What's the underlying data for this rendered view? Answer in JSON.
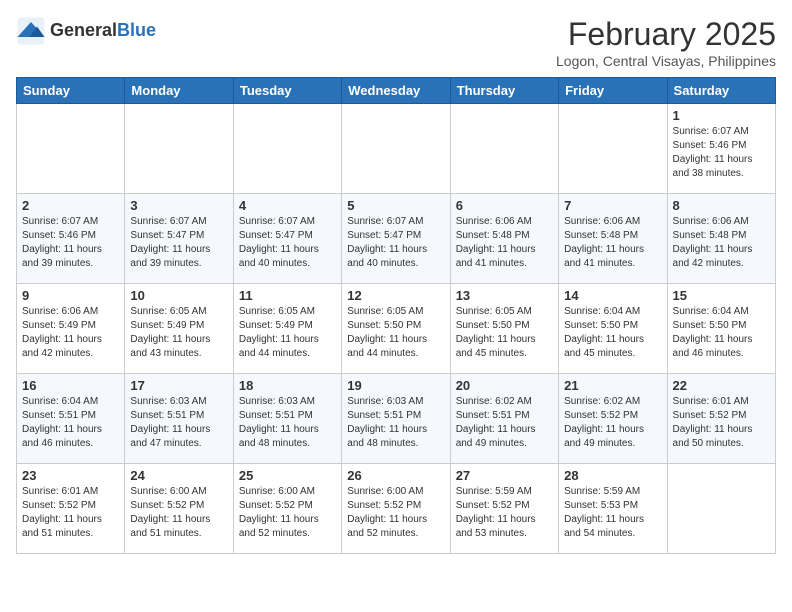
{
  "header": {
    "logo_line1": "General",
    "logo_line2": "Blue",
    "month": "February 2025",
    "location": "Logon, Central Visayas, Philippines"
  },
  "weekdays": [
    "Sunday",
    "Monday",
    "Tuesday",
    "Wednesday",
    "Thursday",
    "Friday",
    "Saturday"
  ],
  "weeks": [
    [
      {
        "day": "",
        "info": ""
      },
      {
        "day": "",
        "info": ""
      },
      {
        "day": "",
        "info": ""
      },
      {
        "day": "",
        "info": ""
      },
      {
        "day": "",
        "info": ""
      },
      {
        "day": "",
        "info": ""
      },
      {
        "day": "1",
        "info": "Sunrise: 6:07 AM\nSunset: 5:46 PM\nDaylight: 11 hours\nand 38 minutes."
      }
    ],
    [
      {
        "day": "2",
        "info": "Sunrise: 6:07 AM\nSunset: 5:46 PM\nDaylight: 11 hours\nand 39 minutes."
      },
      {
        "day": "3",
        "info": "Sunrise: 6:07 AM\nSunset: 5:47 PM\nDaylight: 11 hours\nand 39 minutes."
      },
      {
        "day": "4",
        "info": "Sunrise: 6:07 AM\nSunset: 5:47 PM\nDaylight: 11 hours\nand 40 minutes."
      },
      {
        "day": "5",
        "info": "Sunrise: 6:07 AM\nSunset: 5:47 PM\nDaylight: 11 hours\nand 40 minutes."
      },
      {
        "day": "6",
        "info": "Sunrise: 6:06 AM\nSunset: 5:48 PM\nDaylight: 11 hours\nand 41 minutes."
      },
      {
        "day": "7",
        "info": "Sunrise: 6:06 AM\nSunset: 5:48 PM\nDaylight: 11 hours\nand 41 minutes."
      },
      {
        "day": "8",
        "info": "Sunrise: 6:06 AM\nSunset: 5:48 PM\nDaylight: 11 hours\nand 42 minutes."
      }
    ],
    [
      {
        "day": "9",
        "info": "Sunrise: 6:06 AM\nSunset: 5:49 PM\nDaylight: 11 hours\nand 42 minutes."
      },
      {
        "day": "10",
        "info": "Sunrise: 6:05 AM\nSunset: 5:49 PM\nDaylight: 11 hours\nand 43 minutes."
      },
      {
        "day": "11",
        "info": "Sunrise: 6:05 AM\nSunset: 5:49 PM\nDaylight: 11 hours\nand 44 minutes."
      },
      {
        "day": "12",
        "info": "Sunrise: 6:05 AM\nSunset: 5:50 PM\nDaylight: 11 hours\nand 44 minutes."
      },
      {
        "day": "13",
        "info": "Sunrise: 6:05 AM\nSunset: 5:50 PM\nDaylight: 11 hours\nand 45 minutes."
      },
      {
        "day": "14",
        "info": "Sunrise: 6:04 AM\nSunset: 5:50 PM\nDaylight: 11 hours\nand 45 minutes."
      },
      {
        "day": "15",
        "info": "Sunrise: 6:04 AM\nSunset: 5:50 PM\nDaylight: 11 hours\nand 46 minutes."
      }
    ],
    [
      {
        "day": "16",
        "info": "Sunrise: 6:04 AM\nSunset: 5:51 PM\nDaylight: 11 hours\nand 46 minutes."
      },
      {
        "day": "17",
        "info": "Sunrise: 6:03 AM\nSunset: 5:51 PM\nDaylight: 11 hours\nand 47 minutes."
      },
      {
        "day": "18",
        "info": "Sunrise: 6:03 AM\nSunset: 5:51 PM\nDaylight: 11 hours\nand 48 minutes."
      },
      {
        "day": "19",
        "info": "Sunrise: 6:03 AM\nSunset: 5:51 PM\nDaylight: 11 hours\nand 48 minutes."
      },
      {
        "day": "20",
        "info": "Sunrise: 6:02 AM\nSunset: 5:51 PM\nDaylight: 11 hours\nand 49 minutes."
      },
      {
        "day": "21",
        "info": "Sunrise: 6:02 AM\nSunset: 5:52 PM\nDaylight: 11 hours\nand 49 minutes."
      },
      {
        "day": "22",
        "info": "Sunrise: 6:01 AM\nSunset: 5:52 PM\nDaylight: 11 hours\nand 50 minutes."
      }
    ],
    [
      {
        "day": "23",
        "info": "Sunrise: 6:01 AM\nSunset: 5:52 PM\nDaylight: 11 hours\nand 51 minutes."
      },
      {
        "day": "24",
        "info": "Sunrise: 6:00 AM\nSunset: 5:52 PM\nDaylight: 11 hours\nand 51 minutes."
      },
      {
        "day": "25",
        "info": "Sunrise: 6:00 AM\nSunset: 5:52 PM\nDaylight: 11 hours\nand 52 minutes."
      },
      {
        "day": "26",
        "info": "Sunrise: 6:00 AM\nSunset: 5:52 PM\nDaylight: 11 hours\nand 52 minutes."
      },
      {
        "day": "27",
        "info": "Sunrise: 5:59 AM\nSunset: 5:52 PM\nDaylight: 11 hours\nand 53 minutes."
      },
      {
        "day": "28",
        "info": "Sunrise: 5:59 AM\nSunset: 5:53 PM\nDaylight: 11 hours\nand 54 minutes."
      },
      {
        "day": "",
        "info": ""
      }
    ]
  ]
}
